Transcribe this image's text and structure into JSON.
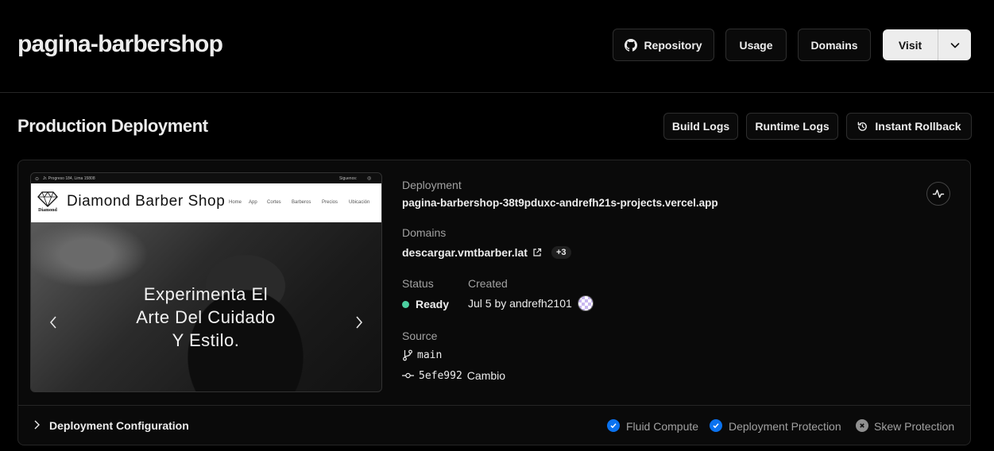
{
  "header": {
    "project_title": "pagina-barbershop",
    "repository_label": "Repository",
    "usage_label": "Usage",
    "domains_label": "Domains",
    "visit_label": "Visit"
  },
  "production": {
    "heading": "Production Deployment",
    "build_logs_label": "Build Logs",
    "runtime_logs_label": "Runtime Logs",
    "rollback_label": "Instant Rollback"
  },
  "preview": {
    "address": "Jr. Progreso 184, Lima 15808",
    "follow_label": "Siguenos:",
    "logo_text": "Diamond",
    "site_title": "Diamond Barber Shop",
    "nav": [
      "Home",
      "App",
      "Cortes",
      "Barberos",
      "Precios",
      "Ubicación"
    ],
    "hero_lines": [
      "Experimenta El",
      "Arte Del Cuidado",
      "Y Estilo."
    ]
  },
  "details": {
    "deployment_label": "Deployment",
    "deployment_url": "pagina-barbershop-38t9pduxc-andrefh21s-projects.vercel.app",
    "domains_label": "Domains",
    "domain": "descargar.vmtbarber.lat",
    "domain_extra": "+3",
    "status_label": "Status",
    "status_value": "Ready",
    "status_color": "#4ccfa0",
    "created_label": "Created",
    "created_value": "Jul 5 by andrefh2101",
    "source_label": "Source",
    "branch": "main",
    "commit_hash": "5efe992",
    "commit_message": "Cambio"
  },
  "config": {
    "label": "Deployment Configuration",
    "fluid_compute": "Fluid Compute",
    "deployment_protection": "Deployment Protection",
    "skew_protection": "Skew Protection",
    "enabled_color": "#0a72ef",
    "disabled_color": "#8f8f8f"
  }
}
